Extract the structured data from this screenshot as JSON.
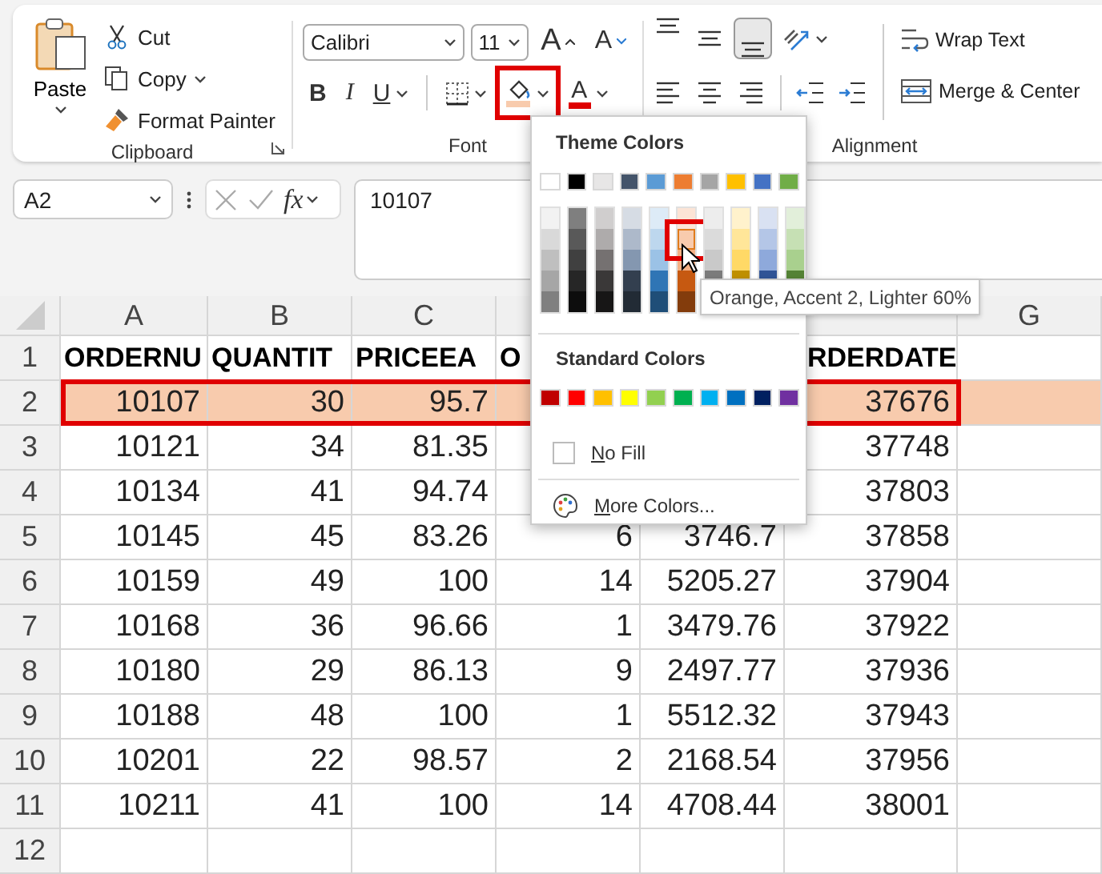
{
  "ribbon": {
    "clipboard": {
      "paste": "Paste",
      "cut": "Cut",
      "copy": "Copy",
      "format_painter": "Format Painter",
      "label": "Clipboard"
    },
    "font": {
      "font_name": "Calibri",
      "font_size": "11",
      "grow": "A",
      "shrink": "A",
      "bold": "B",
      "italic": "I",
      "underline": "U",
      "fill_color_highlighted": true,
      "font_color": "A",
      "label": "Font"
    },
    "alignment": {
      "vertical": [
        {
          "kind": "top",
          "selected": false
        },
        {
          "kind": "middle",
          "selected": false
        },
        {
          "kind": "bottom",
          "selected": true
        }
      ],
      "wrap_text": "Wrap Text",
      "merge_center": "Merge & Center",
      "label": "Alignment"
    }
  },
  "formula_bar": {
    "name_box": "A2",
    "function_label": "fx",
    "value": "10107"
  },
  "sheet": {
    "columns": [
      "A",
      "B",
      "C",
      null,
      null,
      null,
      "G"
    ],
    "rows": [
      {
        "number": "1",
        "kind": "header",
        "highlighted": false,
        "cells": [
          "ORDERNU",
          "QUANTIT",
          "PRICEEA",
          "O",
          null,
          "RDERDATE",
          null
        ]
      },
      {
        "number": "2",
        "kind": "data",
        "highlighted": true,
        "color": "#f8cbad",
        "cells": [
          "10107",
          "30",
          "95.7",
          null,
          null,
          "37676",
          null
        ]
      },
      {
        "number": "3",
        "kind": "data",
        "highlighted": false,
        "cells": [
          "10121",
          "34",
          "81.35",
          null,
          null,
          "37748",
          null
        ]
      },
      {
        "number": "4",
        "kind": "data",
        "highlighted": false,
        "cells": [
          "10134",
          "41",
          "94.74",
          null,
          null,
          "37803",
          null
        ]
      },
      {
        "number": "5",
        "kind": "data",
        "highlighted": false,
        "cells": [
          "10145",
          "45",
          "83.26",
          "6",
          "3746.7",
          "37858",
          null
        ]
      },
      {
        "number": "6",
        "kind": "data",
        "highlighted": false,
        "cells": [
          "10159",
          "49",
          "100",
          "14",
          "5205.27",
          "37904",
          null
        ]
      },
      {
        "number": "7",
        "kind": "data",
        "highlighted": false,
        "cells": [
          "10168",
          "36",
          "96.66",
          "1",
          "3479.76",
          "37922",
          null
        ]
      },
      {
        "number": "8",
        "kind": "data",
        "highlighted": false,
        "cells": [
          "10180",
          "29",
          "86.13",
          "9",
          "2497.77",
          "37936",
          null
        ]
      },
      {
        "number": "9",
        "kind": "data",
        "highlighted": false,
        "cells": [
          "10188",
          "48",
          "100",
          "1",
          "5512.32",
          "37943",
          null
        ]
      },
      {
        "number": "10",
        "kind": "data",
        "highlighted": false,
        "cells": [
          "10201",
          "22",
          "98.57",
          "2",
          "2168.54",
          "37956",
          null
        ]
      },
      {
        "number": "11",
        "kind": "data",
        "highlighted": false,
        "cells": [
          "10211",
          "41",
          "100",
          "14",
          "4708.44",
          "38001",
          null
        ]
      },
      {
        "number": "12",
        "kind": "data",
        "highlighted": false
      }
    ]
  },
  "fill_menu": {
    "theme_title": "Theme Colors",
    "theme_colors": [
      {
        "color": "#ffffff",
        "shades": [
          {
            "color": "#f2f2f2",
            "selected": false
          },
          {
            "color": "#d9d9d9",
            "selected": false
          },
          {
            "color": "#bfbfbf",
            "selected": false
          },
          {
            "color": "#a6a6a6",
            "selected": false
          },
          {
            "color": "#808080",
            "selected": false
          }
        ]
      },
      {
        "color": "#000000",
        "shades": [
          {
            "color": "#7f7f7f",
            "selected": false
          },
          {
            "color": "#595959",
            "selected": false
          },
          {
            "color": "#404040",
            "selected": false
          },
          {
            "color": "#262626",
            "selected": false
          },
          {
            "color": "#0d0d0d",
            "selected": false
          }
        ]
      },
      {
        "color": "#e7e6e6",
        "shades": [
          {
            "color": "#d0cece",
            "selected": false
          },
          {
            "color": "#aeabab",
            "selected": false
          },
          {
            "color": "#757171",
            "selected": false
          },
          {
            "color": "#3a3838",
            "selected": false
          },
          {
            "color": "#171616",
            "selected": false
          }
        ]
      },
      {
        "color": "#44546a",
        "shades": [
          {
            "color": "#d6dce4",
            "selected": false
          },
          {
            "color": "#adb9ca",
            "selected": false
          },
          {
            "color": "#8497b0",
            "selected": false
          },
          {
            "color": "#333f4f",
            "selected": false
          },
          {
            "color": "#222b35",
            "selected": false
          }
        ]
      },
      {
        "color": "#5b9bd5",
        "shades": [
          {
            "color": "#ddebf7",
            "selected": false
          },
          {
            "color": "#bdd7ee",
            "selected": false
          },
          {
            "color": "#9bc2e6",
            "selected": false
          },
          {
            "color": "#2f75b5",
            "selected": false
          },
          {
            "color": "#1f4e78",
            "selected": false
          }
        ]
      },
      {
        "color": "#ed7d31",
        "shades": [
          {
            "color": "#fce4d6",
            "selected": false
          },
          {
            "color": "#f8cbad",
            "selected": true
          },
          {
            "color": "#f4b084",
            "selected": false
          },
          {
            "color": "#c65911",
            "selected": false
          },
          {
            "color": "#833c0c",
            "selected": false
          }
        ]
      },
      {
        "color": "#a5a5a5",
        "shades": [
          {
            "color": "#ededed",
            "selected": false
          },
          {
            "color": "#dbdbdb",
            "selected": false
          },
          {
            "color": "#c9c9c9",
            "selected": false
          },
          {
            "color": "#7b7b7b",
            "selected": false
          }
        ]
      },
      {
        "color": "#ffc000",
        "shades": [
          {
            "color": "#fff2cc",
            "selected": false
          },
          {
            "color": "#ffe699",
            "selected": false
          },
          {
            "color": "#ffd966",
            "selected": false
          },
          {
            "color": "#bf8f00",
            "selected": false
          }
        ]
      },
      {
        "color": "#4472c4",
        "shades": [
          {
            "color": "#d9e1f2",
            "selected": false
          },
          {
            "color": "#b4c6e7",
            "selected": false
          },
          {
            "color": "#8ea9db",
            "selected": false
          },
          {
            "color": "#305496",
            "selected": false
          }
        ]
      },
      {
        "color": "#70ad47",
        "shades": [
          {
            "color": "#e2efda",
            "selected": false
          },
          {
            "color": "#c6e0b4",
            "selected": false
          },
          {
            "color": "#a9d08e",
            "selected": false
          },
          {
            "color": "#548235",
            "selected": false
          }
        ]
      }
    ],
    "standard_title": "Standard Colors",
    "standard_colors": [
      {
        "color": "#c00000"
      },
      {
        "color": "#ff0000"
      },
      {
        "color": "#ffc000"
      },
      {
        "color": "#ffff00"
      },
      {
        "color": "#92d050"
      },
      {
        "color": "#00b050"
      },
      {
        "color": "#00b0f0"
      },
      {
        "color": "#0070c0"
      },
      {
        "color": "#002060"
      },
      {
        "color": "#7030a0"
      }
    ],
    "no_fill": "No Fill",
    "more_colors": "More Colors..."
  },
  "tooltip": "Orange, Accent 2, Lighter 60%"
}
